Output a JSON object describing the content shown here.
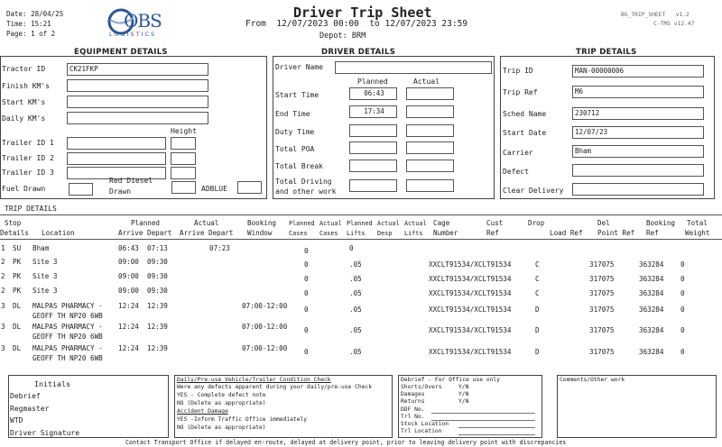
{
  "header": {
    "date_label": "Date:",
    "date": "28/04/25",
    "time_label": "Time:",
    "time": "15:21",
    "page_label": "Page:",
    "page": "1 of 2",
    "logo_text": "OBS",
    "logo_sub": "LOGISTICS",
    "title": "Driver Trip Sheet",
    "from_label": "From",
    "from": "12/07/2023 00:00",
    "to_label": "to",
    "to": "12/07/2023 23:59",
    "depot_label": "Depot:",
    "depot": "BRM",
    "report_code": "BG_TRIP_SHEET",
    "version1": "v1.2",
    "system": "C-TMS",
    "version2": "v12.47"
  },
  "equipment": {
    "heading": "EQUIPMENT DETAILS",
    "tractor_id_label": "Tractor ID",
    "tractor_id": "CK21FKP",
    "finish_km_label": "Finish KM's",
    "start_km_label": "Start KM's",
    "daily_km_label": "Daily KM's",
    "height_label": "Height",
    "trailer1_label": "Trailer ID 1",
    "trailer2_label": "Trailer ID 2",
    "trailer3_label": "Trailer ID 3",
    "fuel_label": "Fuel Drawn",
    "red_diesel_label1": "Red Diesel",
    "red_diesel_label2": "Drawn",
    "adblue_label": "ADBLUE"
  },
  "driver": {
    "heading": "DRIVER DETAILS",
    "name_label": "Driver Name",
    "planned_label": "Planned",
    "actual_label": "Actual",
    "start_time_label": "Start Time",
    "start_time_planned": "06:43",
    "end_time_label": "End Time",
    "end_time_planned": "17:34",
    "duty_time_label": "Duty Time",
    "total_poa_label": "Total POA",
    "total_break_label": "Total Break",
    "total_driving_label1": "Total Driving",
    "total_driving_label2": "and other work"
  },
  "trip": {
    "heading": "TRIP DETAILS",
    "trip_id_label": "Trip ID",
    "trip_id": "MAN-00000006",
    "trip_ref_label": "Trip Ref",
    "trip_ref": "M6",
    "sched_name_label": "Sched Name",
    "sched_name": "230712",
    "start_date_label": "Start Date",
    "start_date": "12/07/23",
    "carrier_label": "Carrier",
    "carrier": "Bham",
    "defect_label": "Defect",
    "clear_delivery_label": "Clear Delivery"
  },
  "trip_details": {
    "heading": "TRIP DETAILS",
    "columns": {
      "stop1": "Stop",
      "stop2": "Details",
      "location": "Location",
      "planned": "Planned",
      "arrive_depart_p": "Arrive Depart",
      "actual": "Actual",
      "arrive_depart_a": "Arrive Depart",
      "booking1": "Booking",
      "booking2": "Window",
      "planned_cases1": "Planned",
      "planned_cases2": "Cases",
      "actual_cases1": "Actual",
      "actual_cases2": "Cases",
      "planned_lifts1": "Planned",
      "planned_lifts2": "Lifts",
      "actual_desp1": "Actual",
      "actual_desp2": "Desp",
      "actual_lifts1": "Actual",
      "actual_lifts2": "Lifts",
      "cage1": "Cage",
      "cage2": "Number",
      "cust1": "Cust",
      "cust2": "Ref",
      "drop1": "Drop",
      "drop2": "Load Ref",
      "del1": "Del",
      "del2": "Point Ref",
      "bref1": "Booking",
      "bref2": "Ref",
      "tw1": "Total",
      "tw2": "Weight"
    },
    "rows": [
      {
        "seq": "1",
        "type": "SU",
        "loc1": "Bham",
        "loc2": "",
        "pa": "06:43",
        "pd": "07:13",
        "aa": "07:23",
        "bw": "",
        "pc": "0",
        "pl": "0",
        "cage": "",
        "load": "",
        "del": "",
        "bref": "",
        "tw": ""
      },
      {
        "seq": "2",
        "type": "PK",
        "loc1": "Site 3",
        "loc2": "",
        "pa": "09:00",
        "pd": "09:30",
        "aa": "",
        "bw": "",
        "pc": "0",
        "pl": ".05",
        "cage": "XXCLT91534/XCLT91534",
        "load": "C",
        "del": "317075",
        "bref": "363284",
        "tw": "0"
      },
      {
        "seq": "2",
        "type": "PK",
        "loc1": "Site 3",
        "loc2": "",
        "pa": "09:00",
        "pd": "09:30",
        "aa": "",
        "bw": "",
        "pc": "0",
        "pl": ".05",
        "cage": "XXCLT91534/XCLT91534",
        "load": "C",
        "del": "317075",
        "bref": "363284",
        "tw": "0"
      },
      {
        "seq": "2",
        "type": "PK",
        "loc1": "Site 3",
        "loc2": "",
        "pa": "09:00",
        "pd": "09:30",
        "aa": "",
        "bw": "",
        "pc": "0",
        "pl": ".05",
        "cage": "XXCLT91534/XCLT91534",
        "load": "C",
        "del": "317075",
        "bref": "363284",
        "tw": "0"
      },
      {
        "seq": "3",
        "type": "DL",
        "loc1": "MALPAS PHARMACY -",
        "loc2": "GEOFF TH NP20 6WB",
        "pa": "12:24",
        "pd": "12:39",
        "aa": "",
        "bw": "07:00-12:00",
        "pc": "0",
        "pl": ".05",
        "cage": "XXCLT91534/XCLT91534",
        "load": "D",
        "del": "317075",
        "bref": "363284",
        "tw": "0"
      },
      {
        "seq": "3",
        "type": "DL",
        "loc1": "MALPAS PHARMACY -",
        "loc2": "GEOFF TH NP20 6WB",
        "pa": "12:24",
        "pd": "12:39",
        "aa": "",
        "bw": "07:00-12:00",
        "pc": "0",
        "pl": ".05",
        "cage": "XXCLT91534/XCLT91534",
        "load": "D",
        "del": "317075",
        "bref": "363284",
        "tw": "0"
      },
      {
        "seq": "3",
        "type": "DL",
        "loc1": "MALPAS PHARMACY -",
        "loc2": "GEOFF TH NP20 6WB",
        "pa": "12:24",
        "pd": "12:39",
        "aa": "",
        "bw": "07:00-12:00",
        "pc": "0",
        "pl": ".05",
        "cage": "XXCLT91534/XCLT91534",
        "load": "D",
        "del": "317075",
        "bref": "363284",
        "tw": "0"
      }
    ]
  },
  "footer": {
    "initials_label": "Initials",
    "debrief": "Debrief",
    "regmaster": "Regmaster",
    "wtd": "WTD",
    "driver_signature": "Driver Signature",
    "check_title": "Daily/Pre-use Vehicle/Trailer Condition Check",
    "check_q": "Were any defects apparent during your daily/pre-use Check",
    "yes1": "YES   - Complete defect note",
    "no1": "NO    (Delete as appropriate)",
    "accident_title": "Accident Damage",
    "yes2": "YES   -Inform Traffic Office immediately",
    "no2": "NO    (Delete as appropriate)",
    "office_title": "Debrief - For Office use only",
    "shorts": "Shorts/Overs",
    "shorts_v": "Y/N",
    "damages": "Damages",
    "damages_v": "Y/N",
    "returns": "Returns",
    "returns_v": "Y/N",
    "ddf": "DDF No.",
    "trl": "Trl No.",
    "stock": "Stock Location",
    "trl_loc": "Trl Location",
    "comments": "Comments/Other work",
    "contact_note": "Contact Transport Office if delayed en-route, delayed at delivery point, prior to leaving delivery point with discrepancies"
  }
}
